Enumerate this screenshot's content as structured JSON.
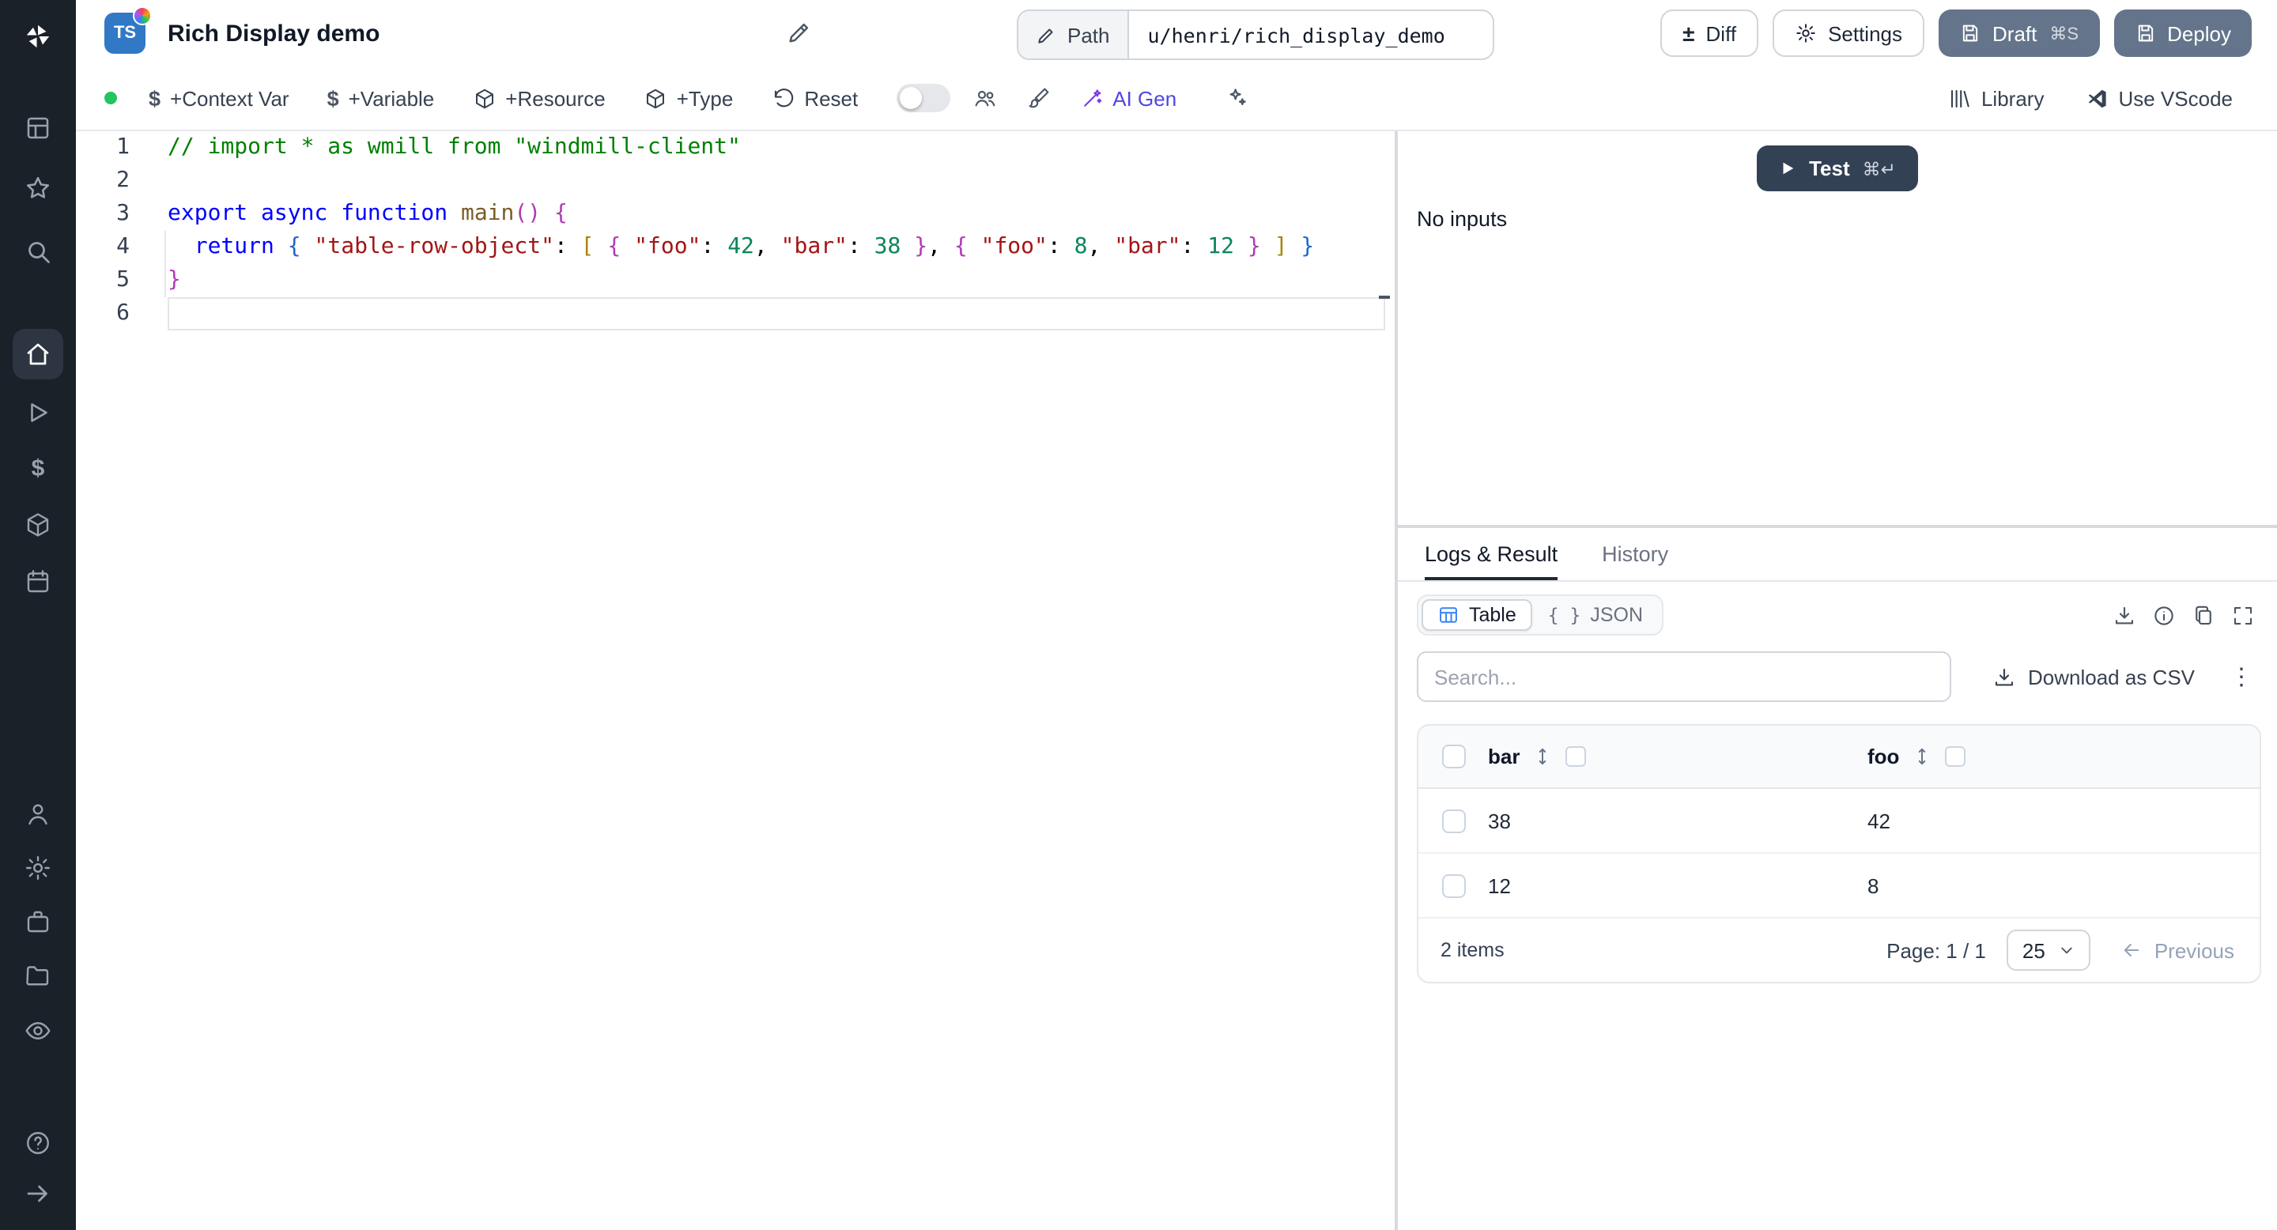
{
  "header": {
    "language_badge": "TS",
    "title": "Rich Display demo",
    "path_label": "Path",
    "path_value": "u/henri/rich_display_demo",
    "diff_label": "Diff",
    "settings_label": "Settings",
    "draft_label": "Draft",
    "draft_shortcut": "⌘S",
    "deploy_label": "Deploy"
  },
  "toolbar": {
    "context_var": "+Context Var",
    "variable": "+Variable",
    "resource": "+Resource",
    "type": "+Type",
    "reset": "Reset",
    "ai_gen": "AI Gen",
    "library": "Library",
    "vscode": "Use VScode"
  },
  "sidebar": {
    "active_item": "home",
    "icons": [
      "windmill-logo",
      "grid",
      "star",
      "search",
      "home",
      "runs",
      "variables",
      "resources",
      "schedules",
      "users",
      "settings",
      "workers",
      "folders",
      "audit-logs",
      "help",
      "collapse"
    ]
  },
  "editor": {
    "line_numbers": [
      "1",
      "2",
      "3",
      "4",
      "5",
      "6"
    ],
    "lines": [
      [
        [
          "com",
          "// import * as wmill from \"windmill-client\""
        ]
      ],
      [],
      [
        [
          "kw",
          "export"
        ],
        [
          "pl",
          " "
        ],
        [
          "kw",
          "async"
        ],
        [
          "pl",
          " "
        ],
        [
          "kw",
          "function"
        ],
        [
          "pl",
          " "
        ],
        [
          "fn",
          "main"
        ],
        [
          "b1",
          "("
        ],
        [
          "b1",
          ")"
        ],
        [
          "pl",
          " "
        ],
        [
          "b1",
          "{"
        ]
      ],
      [
        [
          "pl",
          "  "
        ],
        [
          "kw",
          "return"
        ],
        [
          "pl",
          " "
        ],
        [
          "b2",
          "{"
        ],
        [
          "pl",
          " "
        ],
        [
          "str",
          "\"table-row-object\""
        ],
        [
          "pl",
          ": "
        ],
        [
          "b3",
          "["
        ],
        [
          "pl",
          " "
        ],
        [
          "b1",
          "{"
        ],
        [
          "pl",
          " "
        ],
        [
          "str",
          "\"foo\""
        ],
        [
          "pl",
          ": "
        ],
        [
          "num",
          "42"
        ],
        [
          "pl",
          ", "
        ],
        [
          "str",
          "\"bar\""
        ],
        [
          "pl",
          ": "
        ],
        [
          "num",
          "38"
        ],
        [
          "pl",
          " "
        ],
        [
          "b1",
          "}"
        ],
        [
          "pl",
          ", "
        ],
        [
          "b1",
          "{"
        ],
        [
          "pl",
          " "
        ],
        [
          "str",
          "\"foo\""
        ],
        [
          "pl",
          ": "
        ],
        [
          "num",
          "8"
        ],
        [
          "pl",
          ", "
        ],
        [
          "str",
          "\"bar\""
        ],
        [
          "pl",
          ": "
        ],
        [
          "num",
          "12"
        ],
        [
          "pl",
          " "
        ],
        [
          "b1",
          "}"
        ],
        [
          "pl",
          " "
        ],
        [
          "b3",
          "]"
        ],
        [
          "pl",
          " "
        ],
        [
          "b2",
          "}"
        ]
      ],
      [
        [
          "b1",
          "}"
        ]
      ],
      []
    ]
  },
  "preview": {
    "test_label": "Test",
    "test_shortcut": "⌘↵",
    "no_inputs": "No inputs",
    "tabs": [
      "Logs & Result",
      "History"
    ],
    "active_tab": "Logs & Result",
    "view_toggle": {
      "table": "Table",
      "json": "JSON"
    },
    "search_placeholder": "Search...",
    "download_csv": "Download as CSV",
    "table": {
      "columns": [
        "bar",
        "foo"
      ],
      "rows": [
        [
          "38",
          "42"
        ],
        [
          "12",
          "8"
        ]
      ],
      "items_count": "2 items",
      "page_label": "Page: 1 / 1",
      "page_size": "25",
      "previous_label": "Previous"
    }
  },
  "colors": {
    "sidebar_bg": "#1b2129",
    "slate_button": "#64748b",
    "test_button": "#334155",
    "ai_gen_accent": "#4f46e5",
    "status_dot_green": "#22c55e",
    "table_icon_blue": "#3b82f6"
  }
}
